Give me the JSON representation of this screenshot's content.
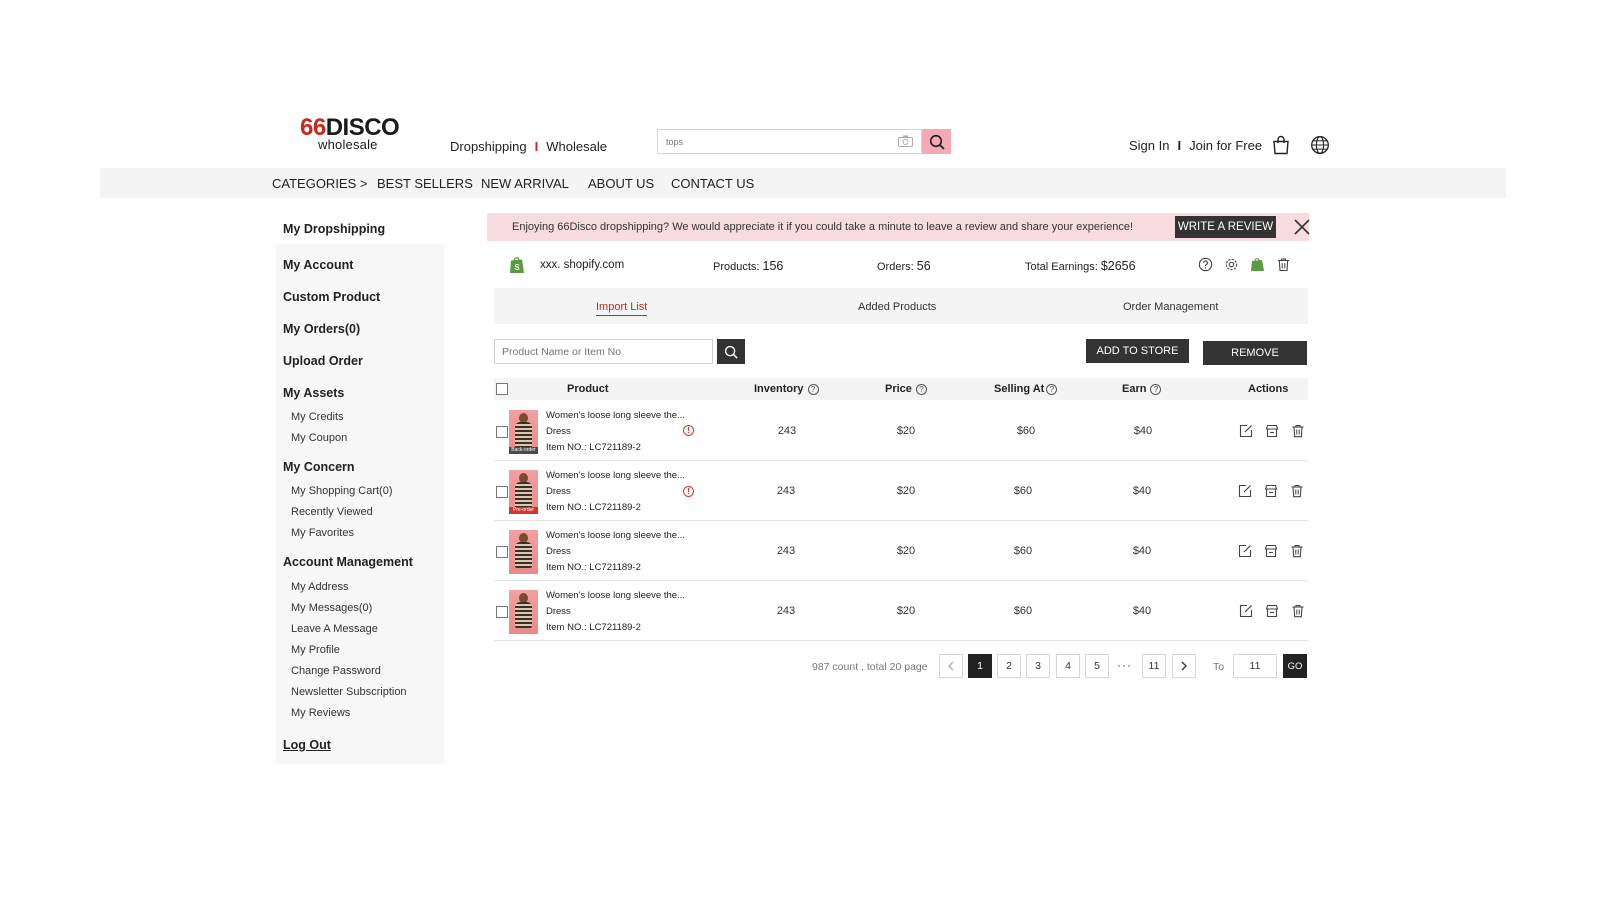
{
  "logo": {
    "number": "66",
    "brand": "DISCO",
    "sub": "wholesale"
  },
  "header": {
    "mode_dropshipping": "Dropshipping",
    "mode_separator": "I",
    "mode_wholesale": "Wholesale",
    "search_placeholder": "tops",
    "sign_in": "Sign In",
    "auth_separator": "I",
    "join": "Join for Free"
  },
  "nav": {
    "categories": "CATEGORIES >",
    "best_sellers": "BEST SELLERS",
    "new_arrival": "NEW ARRIVAL",
    "about_us": "ABOUT US",
    "contact_us": "CONTACT US"
  },
  "sidebar": {
    "my_dropshipping": "My Dropshipping",
    "my_account": "My Account",
    "custom_product": "Custom Product",
    "my_orders": "My Orders(0)",
    "upload_order": "Upload Order",
    "my_assets": "My Assets",
    "my_credits": "My Credits",
    "my_coupon": "My Coupon",
    "my_concern": "My Concern",
    "shopping_cart": "My Shopping Cart(0)",
    "recently_viewed": "Recently Viewed",
    "favorites": "My Favorites",
    "account_management": "Account Management",
    "address": "My Address",
    "messages": "My Messages(0)",
    "leave_message": "Leave A Message",
    "profile": "My Profile",
    "change_password": "Change Password",
    "newsletter": "Newsletter Subscription",
    "reviews": "My Reviews",
    "log_out": "Log Out"
  },
  "banner": {
    "text": "Enjoying 66Disco dropshipping? We would appreciate it if you could take a minute to leave a review and share your experience!",
    "button": "WRITE A REVIEW"
  },
  "store": {
    "name": "xxx. shopify.com",
    "products_label": "Products:",
    "products_value": "156",
    "orders_label": "Orders:",
    "orders_value": "56",
    "earnings_label": "Total Earnings:",
    "earnings_value": "$2656"
  },
  "tabs": {
    "import_list": "Import List",
    "added_products": "Added Products",
    "order_management": "Order Management"
  },
  "toolbar": {
    "search_placeholder": "Product Name or Item No",
    "add_to_store": "ADD TO STORE",
    "remove": "REMOVE"
  },
  "table": {
    "headers": {
      "product": "Product",
      "inventory": "Inventory",
      "price": "Price",
      "selling_at": "Selling At",
      "earn": "Earn",
      "actions": "Actions"
    },
    "rows": [
      {
        "name": "Women's loose long sleeve the...",
        "type": "Dress",
        "item_no": "Item NO.: LC721189-2",
        "tag": "Back-order",
        "inventory": "243",
        "price": "$20",
        "selling_at": "$60",
        "earn": "$40"
      },
      {
        "name": "Women's loose long sleeve the...",
        "type": "Dress",
        "item_no": "Item NO.: LC721189-2",
        "tag": "Pre-order",
        "inventory": "243",
        "price": "$20",
        "selling_at": "$60",
        "earn": "$40"
      },
      {
        "name": "Women's loose long sleeve the...",
        "type": "Dress",
        "item_no": "Item NO.: LC721189-2",
        "tag": "",
        "inventory": "243",
        "price": "$20",
        "selling_at": "$60",
        "earn": "$40"
      },
      {
        "name": "Women's loose long sleeve the...",
        "type": "Dress",
        "item_no": "Item NO.: LC721189-2",
        "tag": "",
        "inventory": "243",
        "price": "$20",
        "selling_at": "$60",
        "earn": "$40"
      }
    ]
  },
  "pagination": {
    "info": "987 count , total 20 page",
    "pages": [
      "1",
      "2",
      "3",
      "4",
      "5"
    ],
    "ellipsis": "···",
    "last_page": "11",
    "to_label": "To",
    "to_value": "11",
    "go": "GO"
  },
  "colors": {
    "brand_red": "#c8281e",
    "search_pink": "#f6a9b4",
    "banner_pink": "#f7dbe0",
    "dark": "#333333",
    "shopify_green": "#5b9a3e"
  }
}
